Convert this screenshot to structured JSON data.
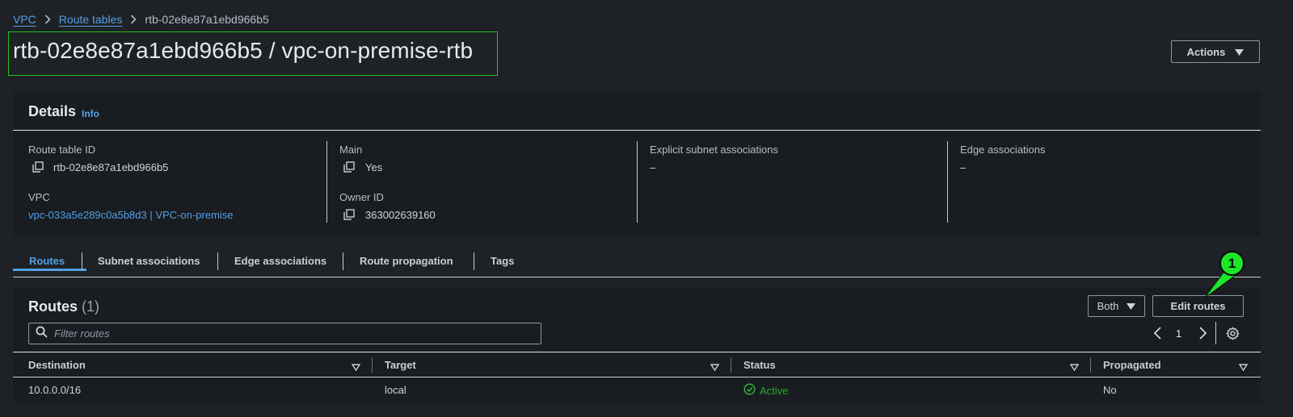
{
  "breadcrumb": {
    "items": [
      {
        "label": "VPC",
        "link": true
      },
      {
        "label": "Route tables",
        "link": true
      },
      {
        "label": "rtb-02e8e87a1ebd966b5",
        "link": false
      }
    ]
  },
  "page": {
    "title": "rtb-02e8e87a1ebd966b5 / vpc-on-premise-rtb",
    "actions_label": "Actions"
  },
  "details": {
    "heading": "Details",
    "info_label": "Info",
    "route_table_id": {
      "label": "Route table ID",
      "value": "rtb-02e8e87a1ebd966b5"
    },
    "vpc": {
      "label": "VPC",
      "value": "vpc-033a5e289c0a5b8d3 | VPC-on-premise"
    },
    "main": {
      "label": "Main",
      "value": "Yes"
    },
    "owner_id": {
      "label": "Owner ID",
      "value": "363002639160"
    },
    "explicit_subnet_associations": {
      "label": "Explicit subnet associations",
      "value": "–"
    },
    "edge_associations": {
      "label": "Edge associations",
      "value": "–"
    }
  },
  "tabs": [
    {
      "label": "Routes",
      "active": true
    },
    {
      "label": "Subnet associations",
      "active": false
    },
    {
      "label": "Edge associations",
      "active": false
    },
    {
      "label": "Route propagation",
      "active": false
    },
    {
      "label": "Tags",
      "active": false
    }
  ],
  "routes": {
    "heading": "Routes",
    "count": "(1)",
    "filter_placeholder": "Filter routes",
    "select_value": "Both",
    "edit_label": "Edit routes",
    "page_number": "1",
    "columns": [
      "Destination",
      "Target",
      "Status",
      "Propagated"
    ],
    "rows": [
      {
        "destination": "10.0.0.0/16",
        "target": "local",
        "status": "Active",
        "propagated": "No"
      }
    ]
  },
  "annotation": {
    "label": "1"
  },
  "colors": {
    "background": "#1e2125",
    "panel": "#191c20",
    "link": "#539fe5",
    "status_active": "#29ad32",
    "highlight_box": "#1fbf2a",
    "annotation_badge": "#1ee62b"
  }
}
